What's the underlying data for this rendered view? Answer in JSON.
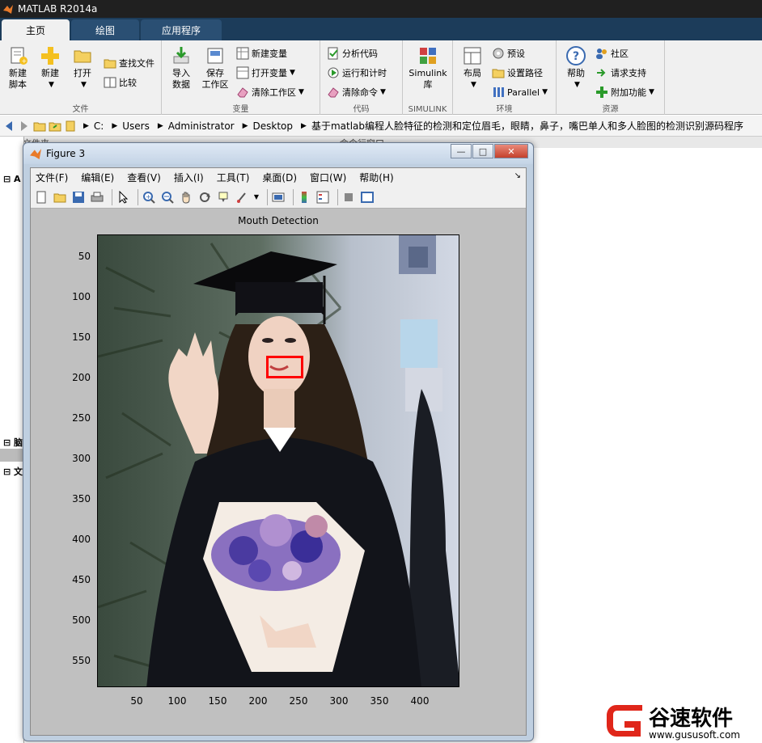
{
  "window": {
    "title": "MATLAB R2014a"
  },
  "tabs": [
    {
      "label": "主页"
    },
    {
      "label": "绘图"
    },
    {
      "label": "应用程序"
    }
  ],
  "ribbon": {
    "file": {
      "label": "文件",
      "new_script": "新建\n脚本",
      "new": "新建",
      "open": "打开",
      "find_files": "查找文件",
      "compare": "比较"
    },
    "variable": {
      "label": "变量",
      "import": "导入\n数据",
      "save_ws": "保存\n工作区",
      "new_var": "新建变量",
      "open_var": "打开变量",
      "clear_ws": "清除工作区"
    },
    "code": {
      "label": "代码",
      "analyze": "分析代码",
      "run_time": "运行和计时",
      "clear_cmd": "清除命令"
    },
    "simulink": {
      "label": "SIMULINK",
      "lib": "Simulink\n库"
    },
    "env": {
      "label": "环境",
      "layout": "布局",
      "prefs": "预设",
      "set_path": "设置路径",
      "parallel": "Parallel"
    },
    "resources": {
      "label": "资源",
      "help": "帮助",
      "community": "社区",
      "support": "请求支持",
      "addons": "附加功能"
    }
  },
  "address": {
    "crumbs": [
      "C:",
      "Users",
      "Administrator",
      "Desktop",
      "基于matlab编程人脸特征的检测和定位眉毛，眼睛，鼻子，嘴巴单人和多人脸图的检测识别源码程序"
    ]
  },
  "panel_head": {
    "left": "当前文件夹",
    "right": "命令行窗口"
  },
  "left_panel": {
    "s1": "A",
    "s2": "脑",
    "s3": "文"
  },
  "figure": {
    "title": "Figure 3",
    "menus": [
      "文件(F)",
      "编辑(E)",
      "查看(V)",
      "插入(I)",
      "工具(T)",
      "桌面(D)",
      "窗口(W)",
      "帮助(H)"
    ],
    "axes_title": "Mouth Detection",
    "y_ticks": [
      "50",
      "100",
      "150",
      "200",
      "250",
      "300",
      "350",
      "400",
      "450",
      "500",
      "550"
    ],
    "x_ticks": [
      "50",
      "100",
      "150",
      "200",
      "250",
      "300",
      "350",
      "400"
    ]
  },
  "watermark": {
    "name": "谷速软件",
    "url": "www.gususoft.com"
  },
  "colors": {
    "accent": "#1c3c5a",
    "box": "#ff0000",
    "logo": "#e0261a"
  }
}
